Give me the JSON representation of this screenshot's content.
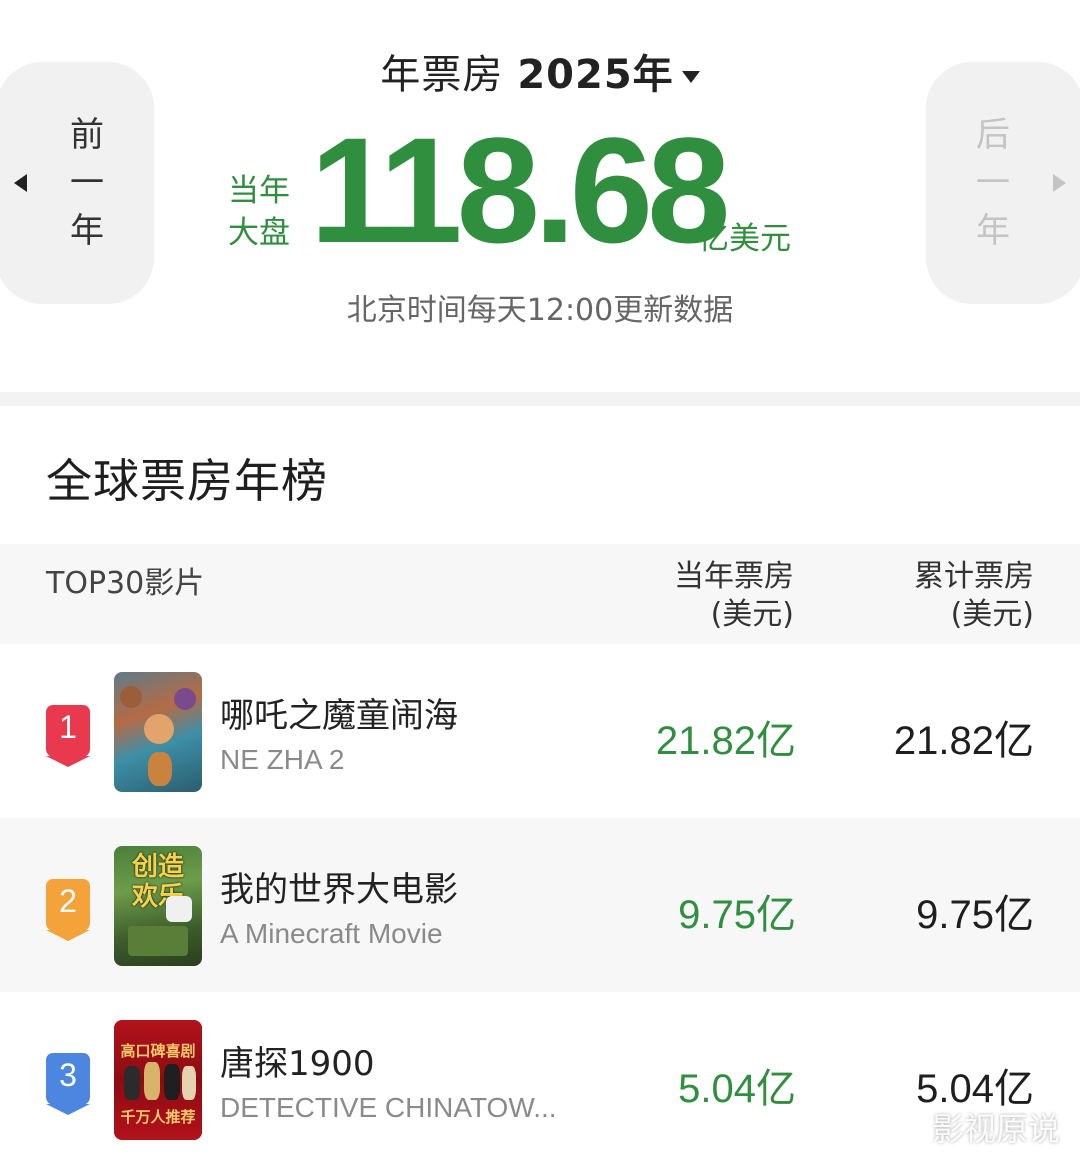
{
  "header": {
    "title_label": "年票房",
    "year_value": "2025年",
    "prev": {
      "chars": [
        "前",
        "一",
        "年"
      ]
    },
    "next": {
      "chars": [
        "后",
        "一",
        "年"
      ]
    },
    "side_label_line1": "当年",
    "side_label_line2": "大盘",
    "total_value": "118.68",
    "unit": "亿美元",
    "update_note": "北京时间每天12:00更新数据"
  },
  "ranking": {
    "section_title": "全球票房年榜",
    "columns": {
      "film": "TOP30影片",
      "year_box_line1": "当年票房",
      "year_box_line2": "(美元)",
      "total_box_line1": "累计票房",
      "total_box_line2": "(美元)"
    },
    "rows": [
      {
        "rank": "1",
        "title_cn": "哪吒之魔童闹海",
        "title_en": "NE ZHA 2",
        "year_box": "21.82亿",
        "total_box": "21.82亿"
      },
      {
        "rank": "2",
        "title_cn": "我的世界大电影",
        "title_en": "A Minecraft Movie",
        "year_box": "9.75亿",
        "total_box": "9.75亿",
        "poster_text": [
          "创造",
          "欢乐"
        ]
      },
      {
        "rank": "3",
        "title_cn": "唐探1900",
        "title_en": "DETECTIVE CHINATOW...",
        "year_box": "5.04亿",
        "total_box": "5.04亿",
        "poster_text": [
          "高口碑喜剧",
          "千万人推荐"
        ]
      }
    ]
  },
  "watermark": "影视原说",
  "colors": {
    "accent_green": "#2f8f3e",
    "rank1": "#e8394f",
    "rank2": "#f4a23a",
    "rank3": "#4d86e0"
  }
}
